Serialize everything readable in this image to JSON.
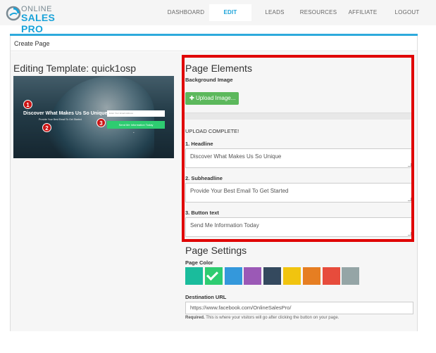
{
  "brand": {
    "line1": "ONLINE",
    "line2": "SALES PRO"
  },
  "nav": [
    "DASHBOARD",
    "EDIT",
    "LEADS",
    "RESOURCES",
    "AFFILIATE",
    "LOGOUT"
  ],
  "panel_title": "Create Page",
  "editing": {
    "label": "Editing Template: quick1osp"
  },
  "preview": {
    "headline": "Discover What Makes Us So Unique",
    "subheadline": "Provide Your Best Email To Get Started",
    "email_placeholder": "Enter Your Email Address",
    "button": "Send Me Information Today",
    "badges": [
      "1",
      "2",
      "3"
    ]
  },
  "elements": {
    "title": "Page Elements",
    "background_label": "Background Image",
    "upload_button": "Upload Image...",
    "upload_status": "UPLOAD COMPLETE!",
    "headline_label": "1. Headline",
    "headline_value": "Discover What Makes Us So Unique",
    "subheadline_label": "2. Subheadline",
    "subheadline_value": "Provide Your Best Email To Get Started",
    "button_label": "3. Button text",
    "button_value": "Send Me Information Today"
  },
  "settings": {
    "title": "Page Settings",
    "color_label": "Page Color",
    "colors": [
      "#1abc9c",
      "#2ecc71",
      "#3498db",
      "#9b59b6",
      "#34495e",
      "#f1c40f",
      "#e67e22",
      "#e74c3c",
      "#95a5a6"
    ],
    "selected_color": "#2ecc71",
    "destination_label": "Destination URL",
    "destination_value": "https://www.facebook.com/OnlineSalesPro/",
    "help_bold": "Required.",
    "help_text": " This is where your visitors will go after clicking the button on your page."
  },
  "accent": "#2eaadc",
  "highlight": "#e00000"
}
